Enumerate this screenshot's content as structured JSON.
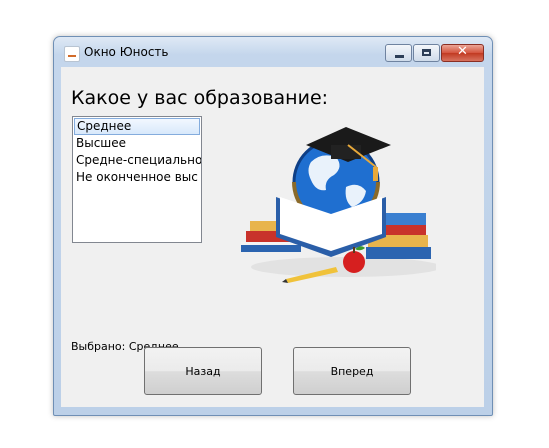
{
  "window": {
    "title": "Окно Юность"
  },
  "controls": {
    "minimize_icon": "minimize-icon",
    "maximize_icon": "maximize-icon",
    "close_icon": "close-icon",
    "close_glyph": "✕"
  },
  "question": "Какое у вас образование:",
  "education_list": {
    "items": [
      "Среднее",
      "Высшее",
      "Средне-специальное",
      "Не оконченное выс"
    ],
    "selected_index": 0
  },
  "selected_text": "Выбрано: Среднее",
  "buttons": {
    "back": "Назад",
    "next": "Вперед"
  },
  "illustration_icon": "education-illustration-icon"
}
